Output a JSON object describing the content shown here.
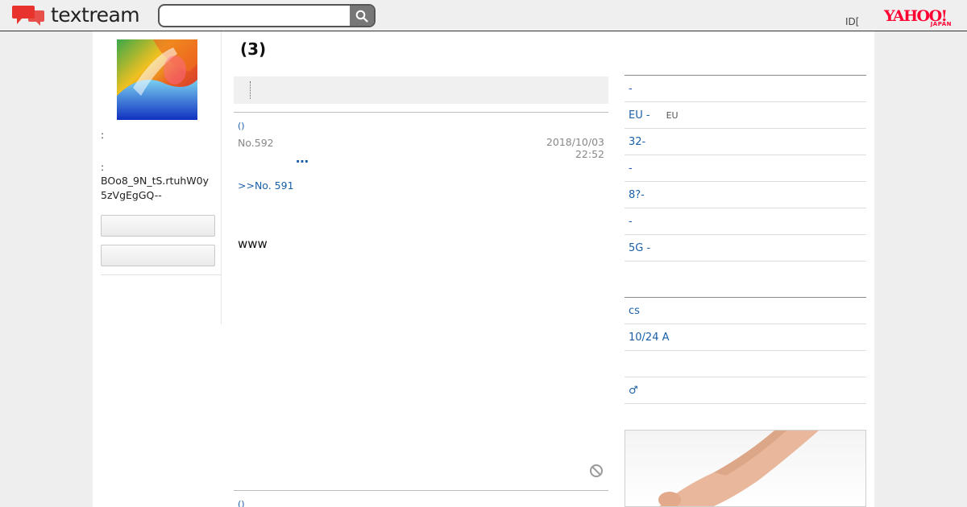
{
  "header": {
    "brand": "textream",
    "search_placeholder": "",
    "id_link": "ID[",
    "yahoo_logo": "YAHOO!",
    "yahoo_sub": "JAPAN"
  },
  "profile": {
    "label_1": ":",
    "label_2": ":",
    "user_id": "BOo8_9N_tS.rtuhW0y5zVgEgGQ--",
    "button_1": "",
    "button_2": ""
  },
  "thread": {
    "title": "(3)"
  },
  "post": {
    "author": "()",
    "number": "No.592",
    "date": "2018/10/03 22:52",
    "more": "…",
    "reply_link": ">>No. 591",
    "body": "www"
  },
  "post2": {
    "author": "()"
  },
  "sidebar": {
    "list_1": [
      {
        "label": "-",
        "sub": ""
      },
      {
        "label": "EU -",
        "sub": "EU"
      },
      {
        "label": " 32-",
        "sub": ""
      },
      {
        "label": " -",
        "sub": ""
      },
      {
        "label": " 8?-",
        "sub": ""
      },
      {
        "label": " -",
        "sub": ""
      },
      {
        "label": "5G -",
        "sub": ""
      }
    ],
    "list_2": [
      {
        "label": " cs"
      },
      {
        "label": "10/24 A"
      },
      {
        "label": ""
      },
      {
        "label": "♂"
      }
    ]
  },
  "colors": {
    "link": "#1a5fa8",
    "brand_red": "#e8322d",
    "yahoo_red": "#ff0033"
  }
}
